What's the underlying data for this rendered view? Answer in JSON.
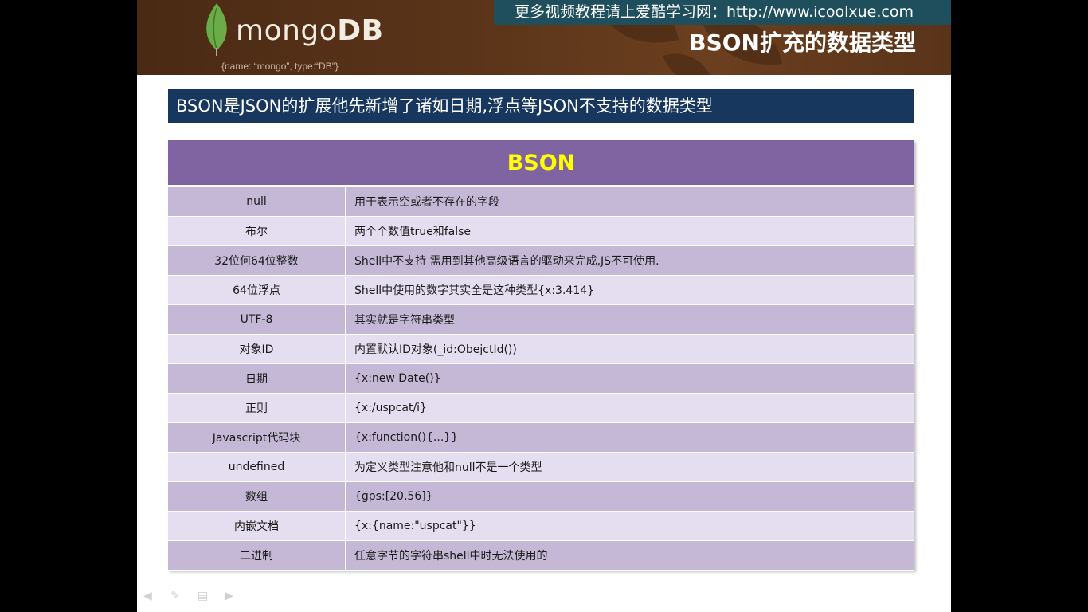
{
  "header": {
    "site_banner": "更多视频教程请上爱酷学习网：http://www.icoolxue.com",
    "logo_text": "mongo",
    "logo_text_bold": "DB",
    "logo_subtitle": "{name: “mongo”, type:“DB”}",
    "slide_title": "BSON扩充的数据类型"
  },
  "subtitle": "BSON是JSON的扩展他先新增了诸如日期,浮点等JSON不支持的数据类型",
  "table": {
    "title": "BSON",
    "rows": [
      {
        "type": "null",
        "desc": "用于表示空或者不存在的字段"
      },
      {
        "type": "布尔",
        "desc": "两个个数值true和false"
      },
      {
        "type": "32位何64位整数",
        "desc": "Shell中不支持 需用到其他高级语言的驱动来完成,JS不可使用."
      },
      {
        "type": "64位浮点",
        "desc": "Shell中使用的数字其实全是这种类型{x:3.414}"
      },
      {
        "type": "UTF-8",
        "desc": "其实就是字符串类型"
      },
      {
        "type": "对象ID",
        "desc": "内置默认ID对象(_id:ObejctId())"
      },
      {
        "type": "日期",
        "desc": "{x:new Date()}"
      },
      {
        "type": "正则",
        "desc": "{x:/uspcat/i}"
      },
      {
        "type": "Javascript代码块",
        "desc": "{x:function(){...}}"
      },
      {
        "type": "undefined",
        "desc": "为定义类型注意他和null不是一个类型"
      },
      {
        "type": "数组",
        "desc": "{gps:[20,56]}"
      },
      {
        "type": "内嵌文档",
        "desc": "{x:{name:\"uspcat\"}}"
      },
      {
        "type": "二进制",
        "desc": "任意字节的字符串shell中时无法使用的"
      }
    ]
  },
  "nav_icons": [
    "arrow-left-icon",
    "pen-icon",
    "menu-icon",
    "arrow-right-icon"
  ],
  "colors": {
    "banner": "#5a3419",
    "site_bar": "#1f4f5c",
    "subtitle_bar": "#17375e",
    "table_header": "#8064a2",
    "table_title": "#ffff00",
    "row_odd": "#c4b8d6",
    "row_even": "#e4def0"
  }
}
